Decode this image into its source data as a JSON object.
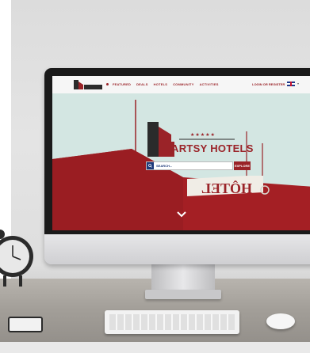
{
  "nav": {
    "links": [
      "FEATURED",
      "DEALS",
      "HOTELS",
      "COMMUNITY",
      "ACTIVITIES"
    ],
    "login": "LOGIN OR REGISTER"
  },
  "hero": {
    "brand": "ARTSY HOTELS",
    "stars": "★★★★★",
    "search_placeholder": "SEARCH...",
    "explore_label": "EXPLORE",
    "sign_text": "HÔTEL"
  },
  "colors": {
    "brand_red": "#9a2328",
    "sky": "#d3e6e2",
    "navy": "#1e3a7a"
  },
  "icons": [
    "logo-mini-icon",
    "search-icon",
    "flag-uk-icon",
    "chevron-down-icon"
  ]
}
